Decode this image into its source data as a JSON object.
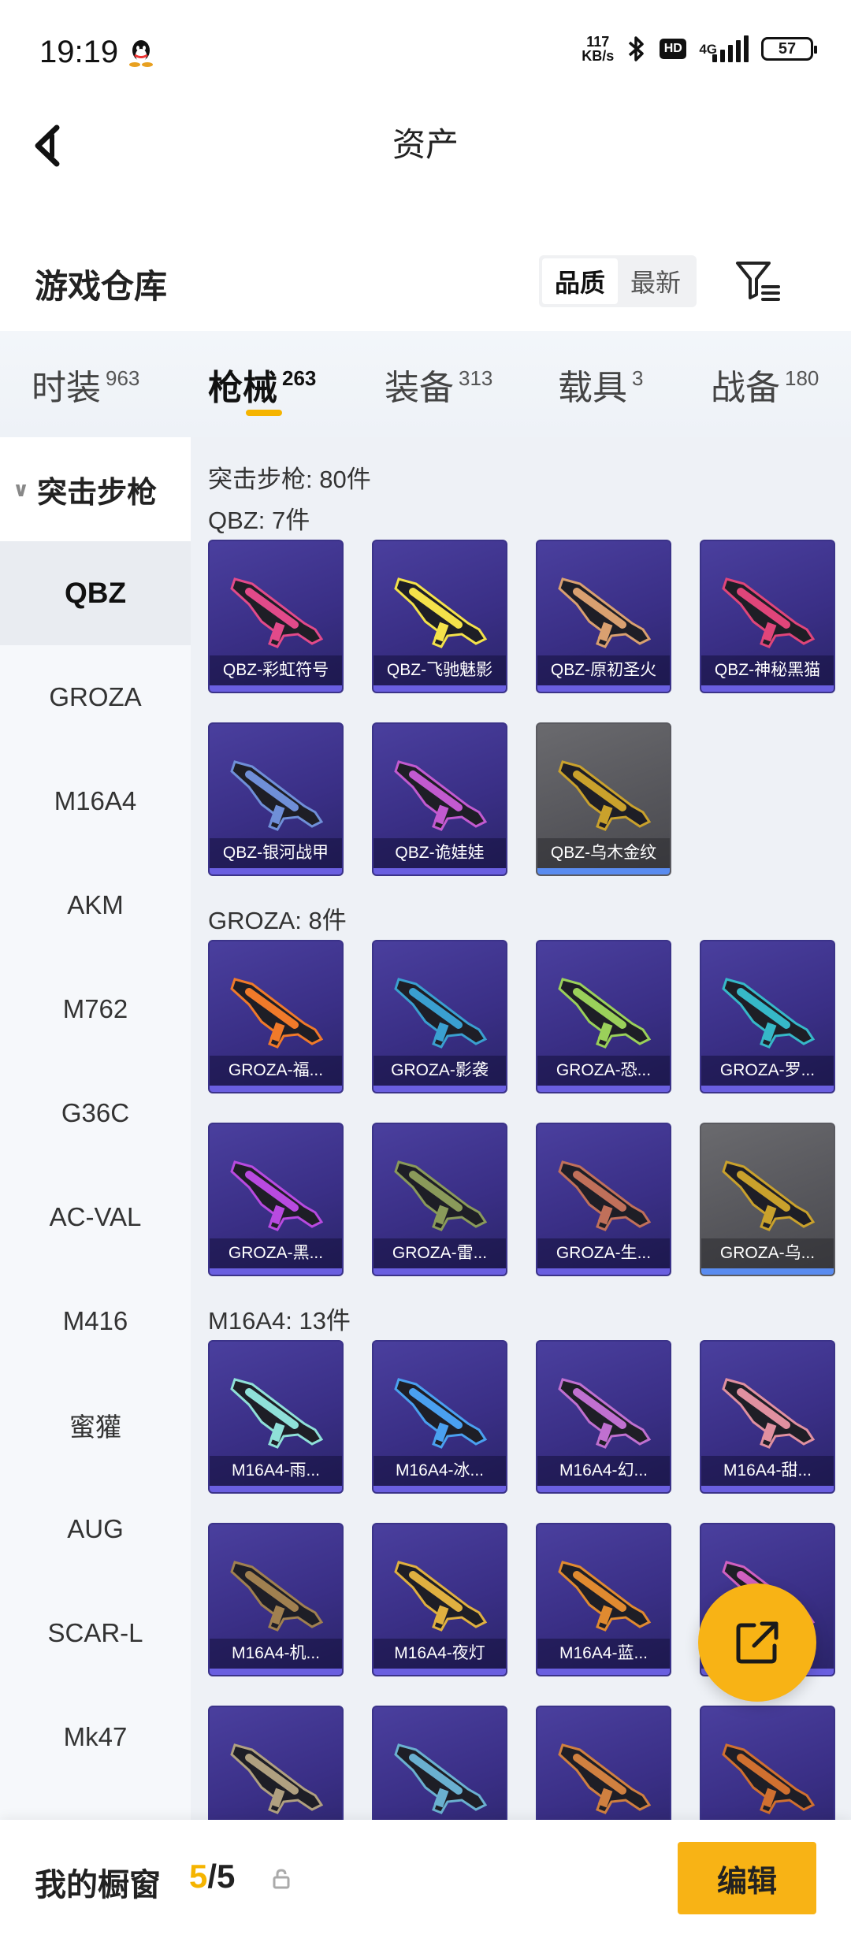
{
  "status_bar": {
    "time": "19:19",
    "net_speed_value": "117",
    "net_speed_unit": "KB/s",
    "hd_label": "HD",
    "network_label": "4G",
    "battery": "57"
  },
  "header": {
    "title": "资产"
  },
  "warehouse": {
    "title": "游戏仓库",
    "sort_options": [
      "品质",
      "最新"
    ],
    "active_sort": "品质"
  },
  "tabs": [
    {
      "label": "时装",
      "count": "963"
    },
    {
      "label": "枪械",
      "count": "263"
    },
    {
      "label": "装备",
      "count": "313"
    },
    {
      "label": "载具",
      "count": "3"
    },
    {
      "label": "战备",
      "count": "180"
    }
  ],
  "sidebar": {
    "group": "突击步枪",
    "items": [
      "QBZ",
      "GROZA",
      "M16A4",
      "AKM",
      "M762",
      "G36C",
      "AC-VAL",
      "M416",
      "蜜獾",
      "AUG",
      "SCAR-L",
      "Mk47"
    ],
    "active_item": "QBZ"
  },
  "main": {
    "total_label": "突击步枪: 80件",
    "sections": [
      {
        "title": "QBZ: 7件",
        "items": [
          {
            "label": "QBZ-彩虹符号",
            "rarity": "purple",
            "accent": "#e24a8a"
          },
          {
            "label": "QBZ-飞驰魅影",
            "rarity": "purple",
            "accent": "#f4e24a"
          },
          {
            "label": "QBZ-原初圣火",
            "rarity": "purple",
            "accent": "#d9a070"
          },
          {
            "label": "QBZ-神秘黑猫",
            "rarity": "purple",
            "accent": "#e0457a"
          },
          {
            "label": "QBZ-银河战甲",
            "rarity": "purple",
            "accent": "#6f8fd8"
          },
          {
            "label": "QBZ-诡娃娃",
            "rarity": "purple",
            "accent": "#c25ad0"
          },
          {
            "label": "QBZ-乌木金纹",
            "rarity": "gray",
            "accent": "#c9a12c"
          }
        ]
      },
      {
        "title": "GROZA: 8件",
        "items": [
          {
            "label": "GROZA-福...",
            "rarity": "purple",
            "accent": "#f07a2a"
          },
          {
            "label": "GROZA-影袭",
            "rarity": "purple",
            "accent": "#3a9fd0"
          },
          {
            "label": "GROZA-恐...",
            "rarity": "purple",
            "accent": "#9ad05a"
          },
          {
            "label": "GROZA-罗...",
            "rarity": "purple",
            "accent": "#36b8c8"
          },
          {
            "label": "GROZA-黑...",
            "rarity": "purple",
            "accent": "#b84ae0"
          },
          {
            "label": "GROZA-雷...",
            "rarity": "purple",
            "accent": "#8a9a5a"
          },
          {
            "label": "GROZA-生...",
            "rarity": "purple",
            "accent": "#c0705a"
          },
          {
            "label": "GROZA-乌...",
            "rarity": "gray",
            "accent": "#c9a12c"
          }
        ]
      },
      {
        "title": "M16A4: 13件",
        "items": [
          {
            "label": "M16A4-雨...",
            "rarity": "purple",
            "accent": "#8fe0d8"
          },
          {
            "label": "M16A4-冰...",
            "rarity": "purple",
            "accent": "#4aa0f0"
          },
          {
            "label": "M16A4-幻...",
            "rarity": "purple",
            "accent": "#c070d0"
          },
          {
            "label": "M16A4-甜...",
            "rarity": "purple",
            "accent": "#e090a0"
          },
          {
            "label": "M16A4-机...",
            "rarity": "purple",
            "accent": "#a08050"
          },
          {
            "label": "M16A4-夜灯",
            "rarity": "purple",
            "accent": "#e0b040"
          },
          {
            "label": "M16A4-蓝...",
            "rarity": "purple",
            "accent": "#e08a30"
          },
          {
            "label": "",
            "rarity": "purple",
            "accent": "#d060c0"
          },
          {
            "label": "",
            "rarity": "purple",
            "accent": "#b0a080"
          },
          {
            "label": "",
            "rarity": "purple",
            "accent": "#6ab0d0"
          },
          {
            "label": "",
            "rarity": "purple",
            "accent": "#d08040"
          },
          {
            "label": "",
            "rarity": "purple",
            "accent": "#d07030"
          }
        ]
      }
    ]
  },
  "showcase": {
    "title": "我的橱窗",
    "current": "5",
    "separator": "/",
    "max": "5",
    "edit_label": "编辑"
  },
  "colors": {
    "accent": "#f8b315",
    "card_purple": "#3a2f86",
    "card_gray": "#55555a"
  }
}
